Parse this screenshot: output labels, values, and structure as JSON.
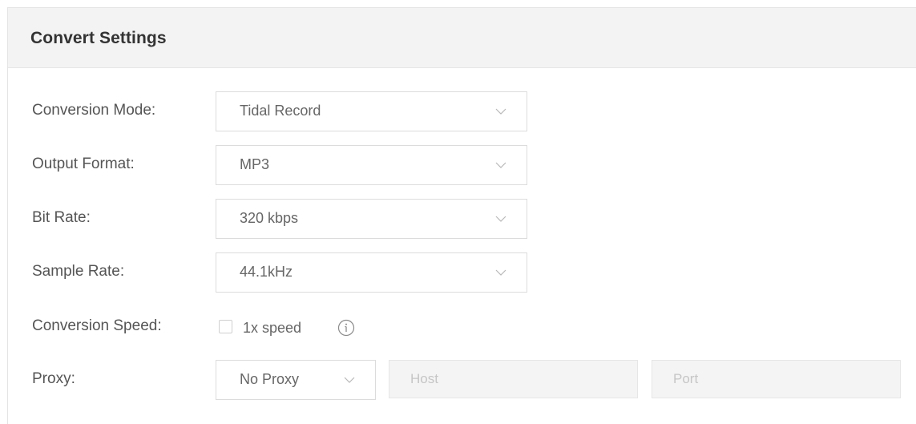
{
  "panel": {
    "title": "Convert Settings"
  },
  "settings": {
    "conversion_mode": {
      "label": "Conversion Mode:",
      "value": "Tidal Record"
    },
    "output_format": {
      "label": "Output Format:",
      "value": "MP3"
    },
    "bit_rate": {
      "label": "Bit Rate:",
      "value": "320 kbps"
    },
    "sample_rate": {
      "label": "Sample Rate:",
      "value": "44.1kHz"
    },
    "conversion_speed": {
      "label": "Conversion Speed:",
      "checkbox_label": "1x speed",
      "checked": false,
      "info_icon": "info-icon"
    },
    "proxy": {
      "label": "Proxy:",
      "value": "No Proxy",
      "host_placeholder": "Host",
      "port_placeholder": "Port"
    }
  },
  "icons": {
    "dropdown": "chevron-down-icon",
    "info": "info-circle-icon"
  },
  "colors": {
    "header_bg": "#f3f3f3",
    "label": "#555555",
    "border": "#dcdcdc",
    "input_disabled_bg": "#f4f4f4"
  }
}
